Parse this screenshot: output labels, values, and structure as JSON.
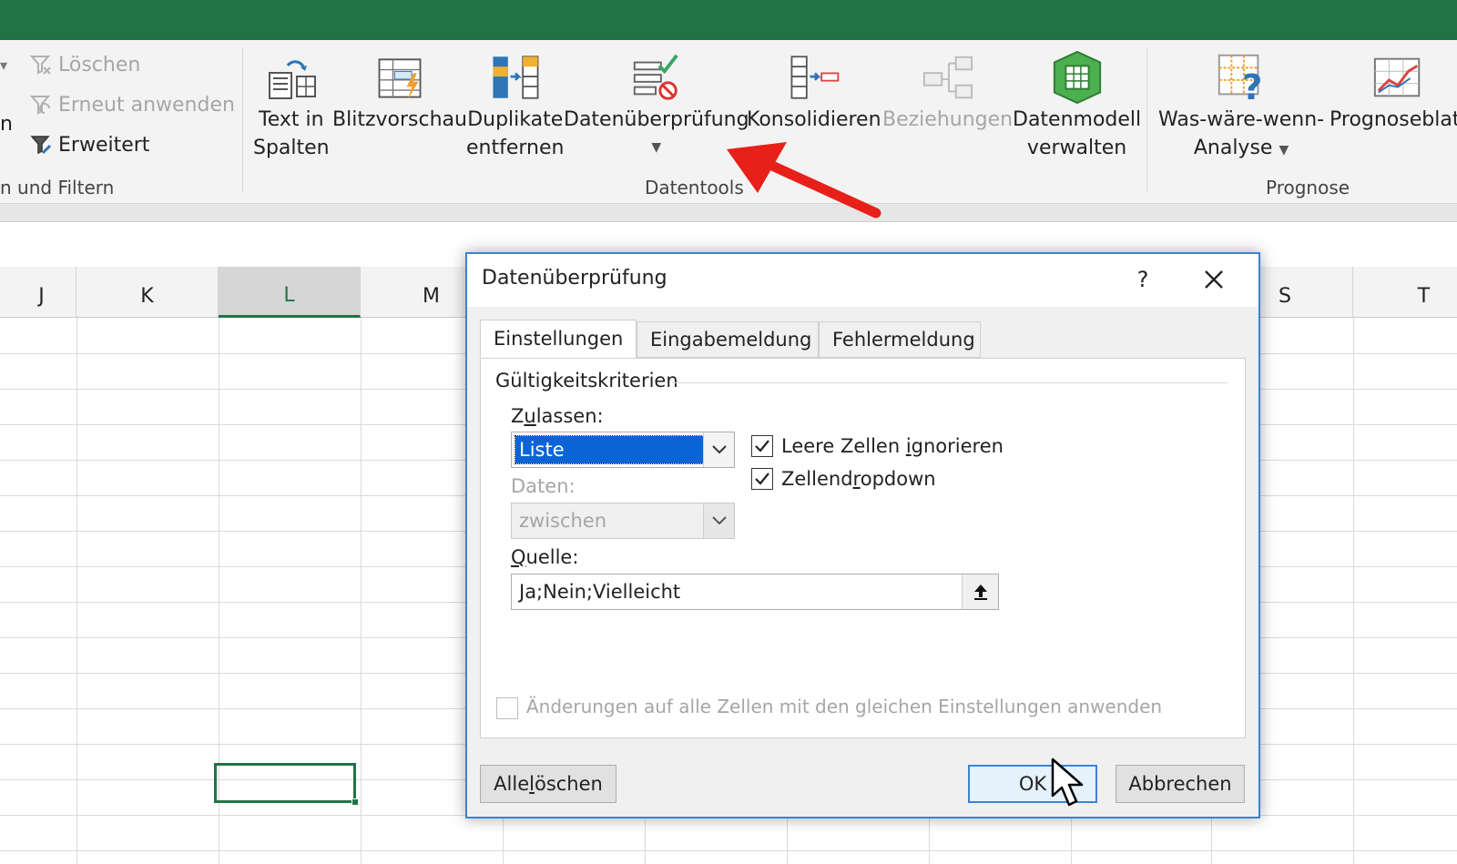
{
  "ribbon": {
    "sort_filter": {
      "group_label": "n und Filtern",
      "partial_label": "n",
      "clear_label": "Löschen",
      "reapply_label": "Erneut anwenden",
      "advanced_label": "Erweitert"
    },
    "data_tools": {
      "group_label": "Datentools",
      "text_to_columns_line1": "Text in",
      "text_to_columns_line2": "Spalten",
      "flash_fill_label": "Blitzvorschau",
      "remove_dup_line1": "Duplikate",
      "remove_dup_line2": "entfernen",
      "data_validation_label": "Datenüberprüfung",
      "consolidate_label": "Konsolidieren",
      "relationships_label": "Beziehungen",
      "data_model_line1": "Datenmodell",
      "data_model_line2": "verwalten"
    },
    "forecast": {
      "group_label": "Prognose",
      "what_if_line1": "Was-wäre-wenn-",
      "what_if_line2": "Analyse",
      "forecast_sheet_label": "Prognoseblatt"
    }
  },
  "grid": {
    "columns": [
      "J",
      "K",
      "L",
      "M",
      "S",
      "T"
    ],
    "selected_column": "L"
  },
  "dialog": {
    "title": "Datenüberprüfung",
    "help_label": "?",
    "tabs": [
      "Einstellungen",
      "Eingabemeldung",
      "Fehlermeldung"
    ],
    "active_tab": "Einstellungen",
    "section_title": "Gültigkeitskriterien",
    "allow_label_pre": "Z",
    "allow_label_u": "u",
    "allow_label_post": "lassen:",
    "allow_value": "Liste",
    "data_label": "Daten:",
    "data_value": "zwischen",
    "source_label_u": "Q",
    "source_label_post": "uelle:",
    "source_value": "Ja;Nein;Vielleicht",
    "ignore_blank_pre": "Leere Zellen ",
    "ignore_blank_u": "i",
    "ignore_blank_post": "gnorieren",
    "ignore_blank_checked": true,
    "in_cell_pre": "Zellend",
    "in_cell_u": "r",
    "in_cell_post": "opdown",
    "in_cell_checked": true,
    "apply_all_label": "Änderungen auf alle Zellen mit den gleichen Einstellungen anwenden",
    "apply_all_checked": false,
    "clear_all_pre": "Alle ",
    "clear_all_u": "l",
    "clear_all_post": "öschen",
    "ok_label": "OK",
    "cancel_label": "Abbrechen"
  },
  "colors": {
    "excel_green": "#217346",
    "dialog_border": "#3c82d8",
    "selection_blue": "#0a64d6",
    "annotation_arrow": "#e8201a"
  }
}
